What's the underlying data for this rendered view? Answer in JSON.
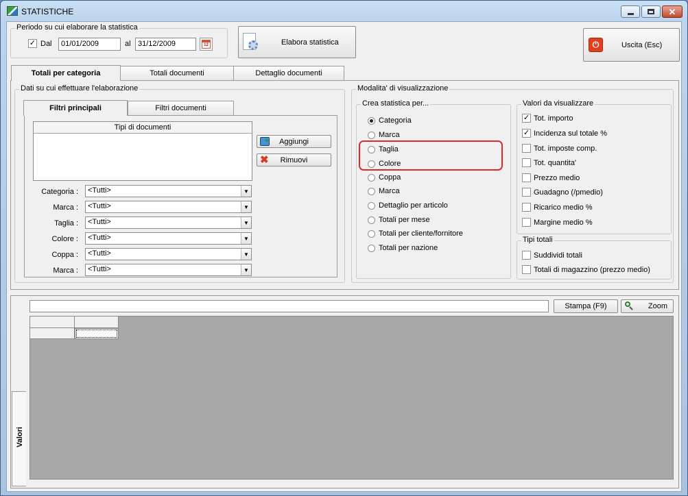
{
  "window": {
    "title": "STATISTICHE"
  },
  "period": {
    "group_label": "Periodo su cui elaborare la statistica",
    "from_checked": true,
    "from_label": "Dal",
    "from_value": "01/01/2009",
    "to_label": "al",
    "to_value": "31/12/2009",
    "calendar_icon_text": "12"
  },
  "toolbar": {
    "process_label": "Elabora statistica",
    "exit_label": "Uscita (Esc)"
  },
  "main_tabs": [
    {
      "label": "Totali per categoria",
      "active": true
    },
    {
      "label": "Totali documenti",
      "active": false
    },
    {
      "label": "Dettaglio documenti",
      "active": false
    }
  ],
  "data_group": {
    "label": "Dati su cui effettuare l'elaborazione",
    "tabs": [
      {
        "label": "Filtri principali",
        "active": true
      },
      {
        "label": "Filtri documenti",
        "active": false
      }
    ],
    "doc_types_header": "Tipi di documenti",
    "add_label": "Aggiungi",
    "remove_label": "Rimuovi",
    "filters": [
      {
        "label": "Categoria :",
        "value": "<Tutti>"
      },
      {
        "label": "Marca :",
        "value": "<Tutti>"
      },
      {
        "label": "Taglia :",
        "value": "<Tutti>"
      },
      {
        "label": "Colore :",
        "value": "<Tutti>"
      },
      {
        "label": "Coppa :",
        "value": "<Tutti>"
      },
      {
        "label": "Marca :",
        "value": "<Tutti>"
      }
    ]
  },
  "display_mode": {
    "label": "Modalita' di visualizzazione",
    "create_by": {
      "label": "Crea statistica per...",
      "options": [
        {
          "label": "Categoria",
          "selected": true
        },
        {
          "label": "Marca",
          "selected": false
        },
        {
          "label": "Taglia",
          "selected": false
        },
        {
          "label": "Colore",
          "selected": false
        },
        {
          "label": "Coppa",
          "selected": false
        },
        {
          "label": "Marca",
          "selected": false
        },
        {
          "label": "Dettaglio per articolo",
          "selected": false
        },
        {
          "label": "Totali per mese",
          "selected": false
        },
        {
          "label": "Totali per cliente/fornitore",
          "selected": false
        },
        {
          "label": "Totali per nazione",
          "selected": false
        }
      ]
    },
    "values": {
      "label": "Valori da visualizzare",
      "options": [
        {
          "label": "Tot. importo",
          "checked": true
        },
        {
          "label": "Incidenza sul totale %",
          "checked": true
        },
        {
          "label": "Tot. imposte comp.",
          "checked": false
        },
        {
          "label": "Tot. quantita'",
          "checked": false
        },
        {
          "label": "Prezzo medio",
          "checked": false
        },
        {
          "label": "Guadagno (/pmedio)",
          "checked": false
        },
        {
          "label": "Ricarico medio %",
          "checked": false
        },
        {
          "label": "Margine medio %",
          "checked": false
        }
      ]
    },
    "total_types": {
      "label": "Tipi totali",
      "options": [
        {
          "label": "Suddividi totali",
          "checked": false
        },
        {
          "label": "Totali di magazzino (prezzo medio)",
          "checked": false
        }
      ]
    }
  },
  "results": {
    "vertical_tab": "Valori",
    "print_label": "Stampa (F9)",
    "zoom_label": "Zoom",
    "search_value": ""
  },
  "colors": {
    "grid_area": "#a8a8a8",
    "highlight": "#dd2a32",
    "title_bar": "#bcd4ec"
  }
}
